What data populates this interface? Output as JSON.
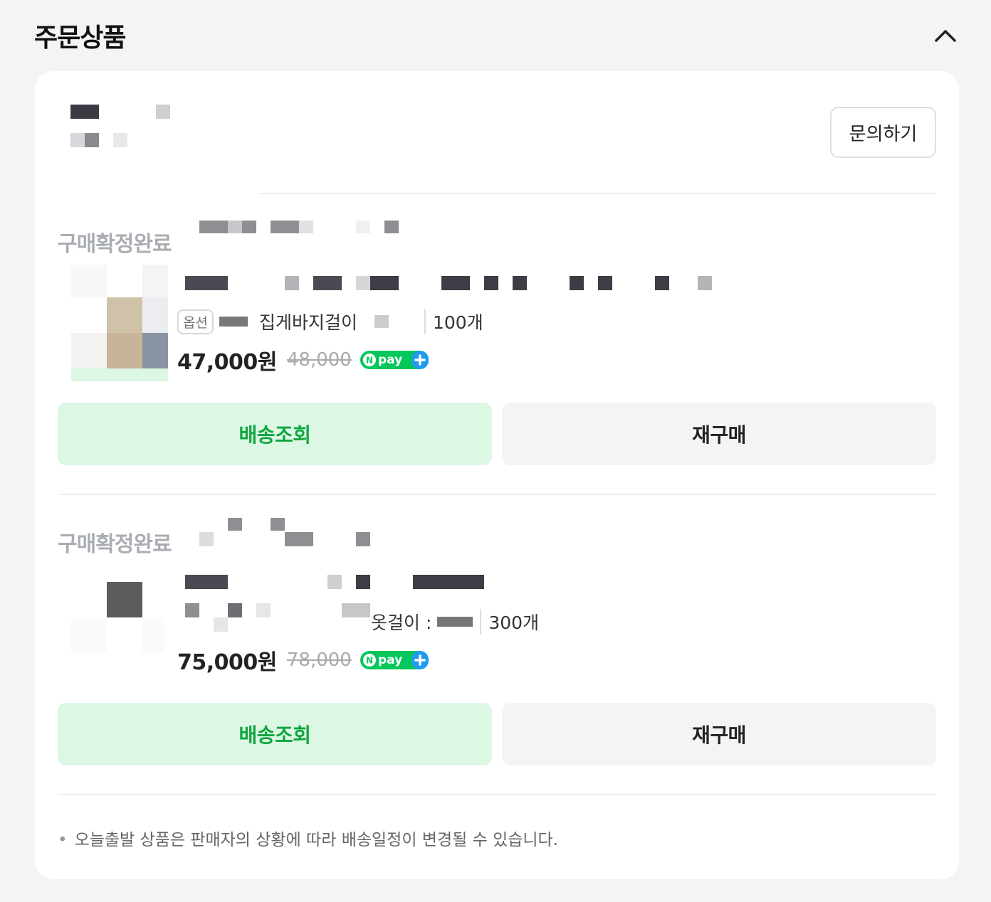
{
  "section": {
    "title": "주문상품",
    "collapse_icon": "chevron-up-icon"
  },
  "seller": {
    "inquiry_label": "문의하기"
  },
  "items": [
    {
      "status": "구매확정완료",
      "option_badge": "옵션",
      "option_text": "집게바지걸이",
      "quantity": "100개",
      "price": "47,000원",
      "original_price": "48,000",
      "track_label": "배송조회",
      "reorder_label": "재구매"
    },
    {
      "status": "구매확정완료",
      "option_badge": "",
      "option_text": "옷걸이 :",
      "quantity": "300개",
      "price": "75,000원",
      "original_price": "78,000",
      "track_label": "배송조회",
      "reorder_label": "재구매"
    }
  ],
  "npay": {
    "label": "pay",
    "icon": "npay-plus-icon"
  },
  "colors": {
    "track_bg": "#dcf8e4",
    "track_text": "#10a640",
    "reorder_bg": "#f3f4f6"
  },
  "notice": "오늘출발 상품은 판매자의 상황에 따라 배송일정이 변경될 수 있습니다."
}
